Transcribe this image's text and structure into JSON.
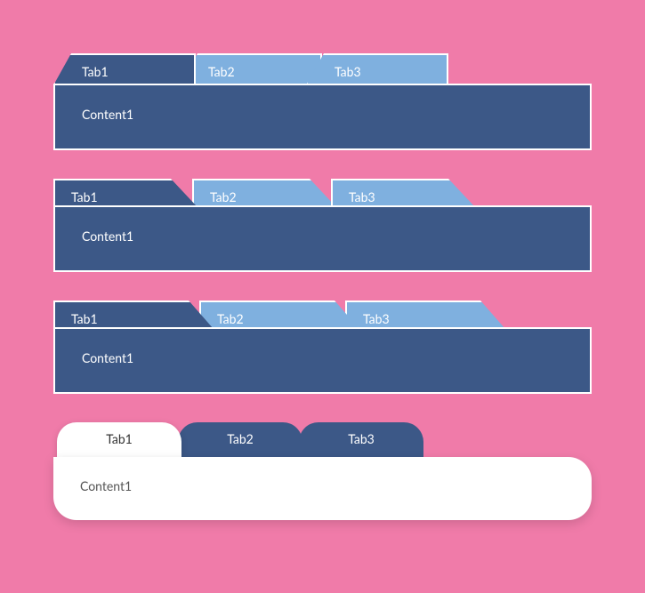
{
  "sets": [
    {
      "tabs": [
        {
          "label": "Tab1",
          "active": true
        },
        {
          "label": "Tab2",
          "active": false
        },
        {
          "label": "Tab3",
          "active": false
        }
      ],
      "content": "Content1"
    },
    {
      "tabs": [
        {
          "label": "Tab1",
          "active": true
        },
        {
          "label": "Tab2",
          "active": false
        },
        {
          "label": "Tab3",
          "active": false
        }
      ],
      "content": "Content1"
    },
    {
      "tabs": [
        {
          "label": "Tab1",
          "active": true
        },
        {
          "label": "Tab2",
          "active": false
        },
        {
          "label": "Tab3",
          "active": false
        }
      ],
      "content": "Content1"
    },
    {
      "tabs": [
        {
          "label": "Tab1",
          "active": true
        },
        {
          "label": "Tab2",
          "active": false
        },
        {
          "label": "Tab3",
          "active": false
        }
      ],
      "content": "Content1"
    }
  ]
}
